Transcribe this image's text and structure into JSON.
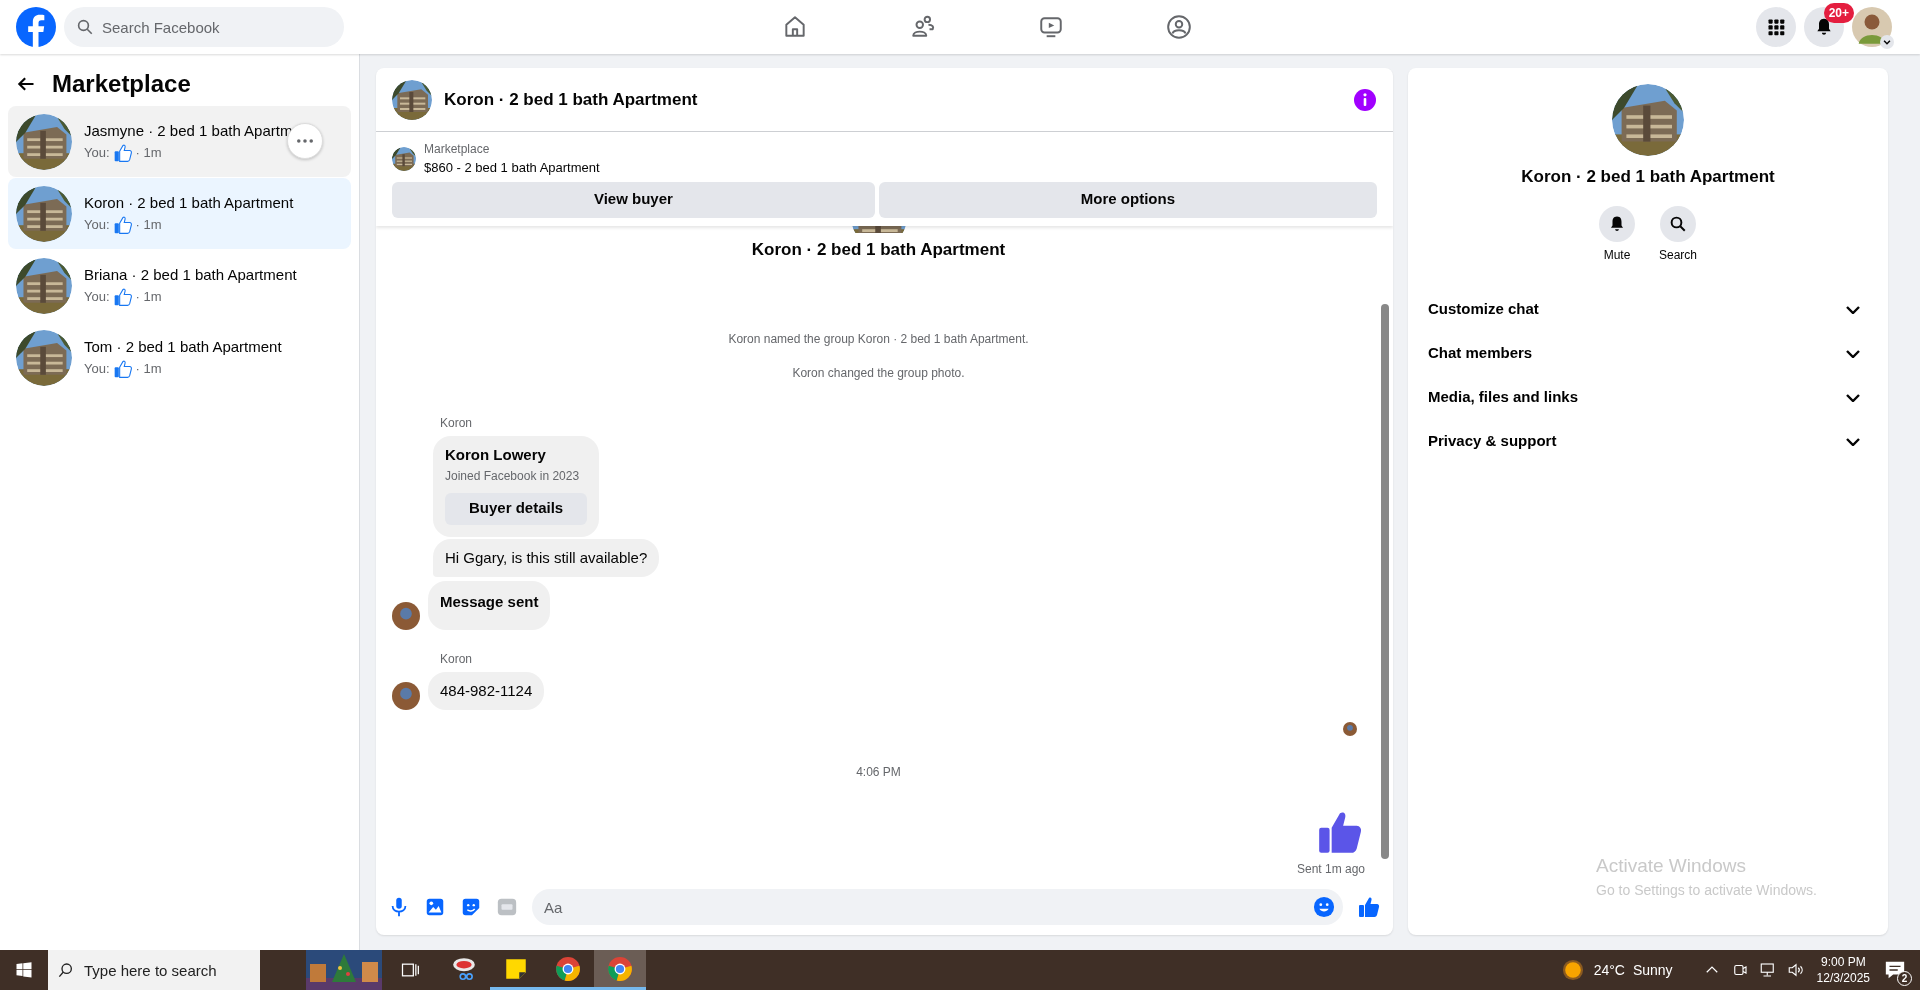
{
  "topbar": {
    "search_placeholder": "Search Facebook",
    "notification_count": "20+"
  },
  "sidebar": {
    "title": "Marketplace",
    "conversations": [
      {
        "name": "Jasmyne · 2 bed 1 bath Apartm",
        "prefix": "You:",
        "time": "· 1m",
        "selected": false,
        "hovered": true
      },
      {
        "name": "Koron · 2 bed 1 bath Apartment",
        "prefix": "You:",
        "time": "· 1m",
        "selected": true,
        "hovered": false
      },
      {
        "name": "Briana · 2 bed 1 bath Apartment",
        "prefix": "You:",
        "time": "· 1m",
        "selected": false,
        "hovered": false
      },
      {
        "name": "Tom · 2 bed 1 bath Apartment",
        "prefix": "You:",
        "time": "· 1m",
        "selected": false,
        "hovered": false
      }
    ]
  },
  "chat": {
    "title": "Koron · 2 bed 1 bath Apartment",
    "listing": {
      "label": "Marketplace",
      "title": "$860 - 2 bed 1 bath Apartment",
      "buttons": [
        "View buyer",
        "More options"
      ]
    },
    "thread": [
      {
        "kind": "title",
        "text": "Koron · 2 bed 1 bath Apartment"
      },
      {
        "kind": "event",
        "text": "Koron named the group Koron · 2 bed 1 bath Apartment."
      },
      {
        "kind": "event",
        "text": "Koron changed the group photo."
      },
      {
        "kind": "sender",
        "text": "Koron"
      },
      {
        "kind": "card",
        "name": "Koron Lowery",
        "subtitle": "Joined Facebook in 2023",
        "button": "Buyer details"
      },
      {
        "kind": "bubble",
        "text": "Hi Ggary, is this still available?",
        "bold": false,
        "avatar": false
      },
      {
        "kind": "bubble",
        "text": "Message sent",
        "bold": true,
        "avatar": true
      },
      {
        "kind": "sender",
        "text": "Koron"
      },
      {
        "kind": "bubble",
        "text": "484-982-1124",
        "bold": false,
        "avatar": true
      },
      {
        "kind": "seen"
      },
      {
        "kind": "time",
        "text": "4:06 PM"
      },
      {
        "kind": "like"
      },
      {
        "kind": "status",
        "text": "Sent 1m ago"
      }
    ],
    "composer_placeholder": "Aa"
  },
  "details": {
    "title": "Koron · 2 bed 1 bath Apartment",
    "actions": [
      {
        "kind": "bell",
        "label": "Mute"
      },
      {
        "kind": "search",
        "label": "Search"
      }
    ],
    "sections": [
      {
        "label": "Customize chat",
        "expanded": false
      },
      {
        "label": "Chat members",
        "expanded": false
      },
      {
        "label": "Media, files and links",
        "expanded": false
      },
      {
        "label": "Privacy & support",
        "expanded": false
      }
    ]
  },
  "activation": {
    "title": "Activate Windows",
    "subtitle": "Go to Settings to activate Windows."
  },
  "taskbar": {
    "search_placeholder": "Type here to search",
    "apps": [
      {
        "kind": "snip",
        "running": false,
        "selected": false
      },
      {
        "kind": "notes",
        "running": true,
        "selected": false
      },
      {
        "kind": "chrome",
        "running": true,
        "selected": false
      },
      {
        "kind": "chrome",
        "running": true,
        "selected": true
      }
    ],
    "temperature": "24°C",
    "weather": "Sunny",
    "time": "9:00 PM",
    "date": "12/3/2025",
    "notifications": "2"
  }
}
